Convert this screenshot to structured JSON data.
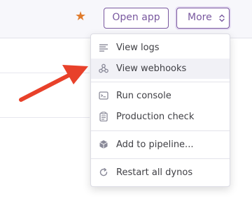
{
  "header": {
    "star_icon": "star-icon",
    "star_color": "#e07b2c",
    "open_app_label": "Open app",
    "more_label": "More",
    "accent_color": "#79589f"
  },
  "menu": {
    "items": [
      {
        "label": "View logs",
        "icon": "logs-icon"
      },
      {
        "label": "View webhooks",
        "icon": "webhooks-icon",
        "highlighted": true
      },
      {
        "label": "Run console",
        "icon": "console-icon"
      },
      {
        "label": "Production check",
        "icon": "clipboard-icon"
      },
      {
        "label": "Add to pipeline...",
        "icon": "pipeline-icon"
      },
      {
        "label": "Restart all dynos",
        "icon": "restart-icon"
      }
    ]
  },
  "annotation": {
    "arrow_color": "#e8412a"
  }
}
